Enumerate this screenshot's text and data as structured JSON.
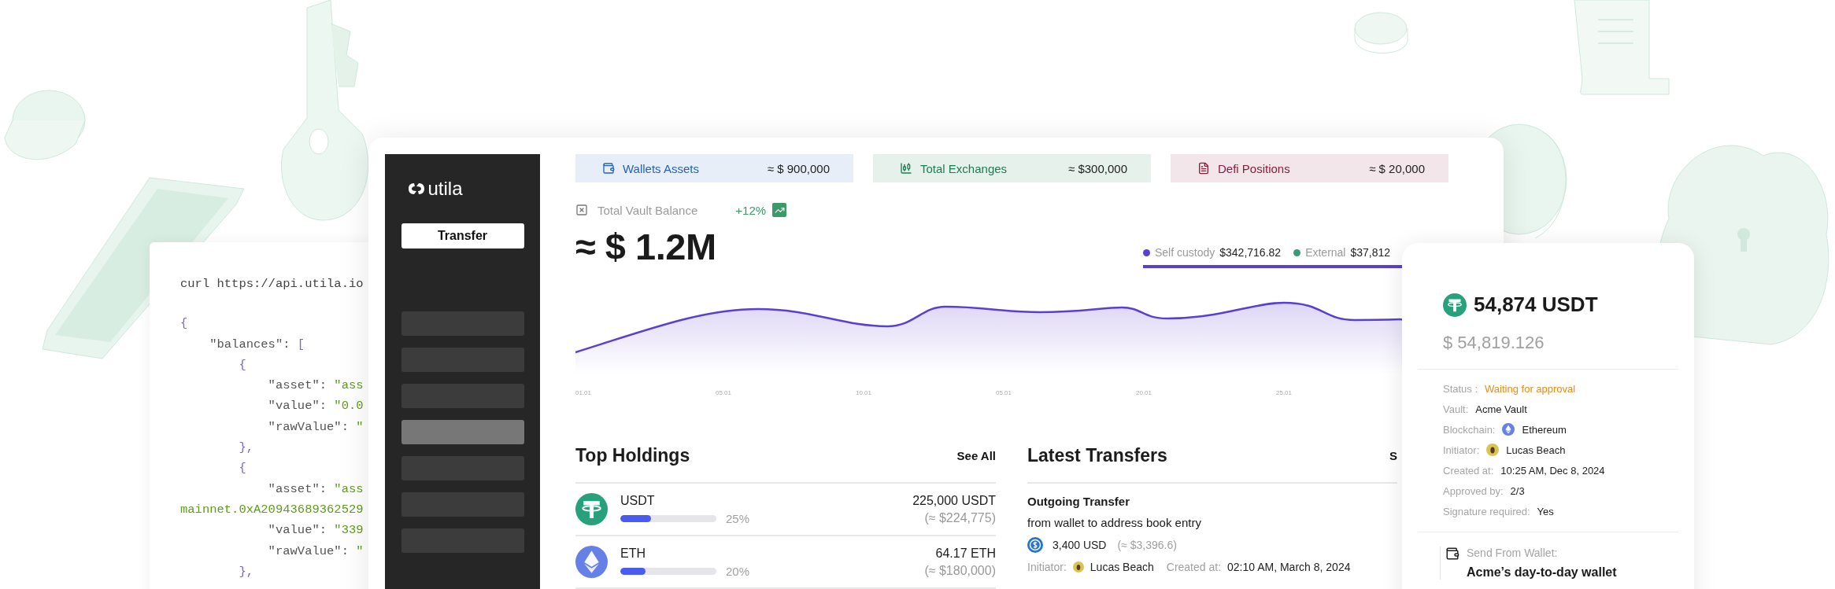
{
  "code_panel": {
    "command": "curl https://api.utila.io",
    "lines": [
      [
        {
          "kind": "punct",
          "text": "{"
        }
      ],
      [
        {
          "kind": "key",
          "text": "    \"balances\": "
        },
        {
          "kind": "punct",
          "text": "["
        }
      ],
      [
        {
          "kind": "punct",
          "text": "        {"
        }
      ],
      [
        {
          "kind": "key",
          "text": "            \"asset\": "
        },
        {
          "kind": "string",
          "text": "\"ass"
        }
      ],
      [
        {
          "kind": "key",
          "text": "            \"value\": "
        },
        {
          "kind": "string",
          "text": "\"0.0"
        }
      ],
      [
        {
          "kind": "key",
          "text": "            \"rawValue\": "
        },
        {
          "kind": "string",
          "text": "\""
        }
      ],
      [
        {
          "kind": "punct",
          "text": "        },"
        }
      ],
      [
        {
          "kind": "punct",
          "text": "        {"
        }
      ],
      [
        {
          "kind": "key",
          "text": "            \"asset\": "
        },
        {
          "kind": "string",
          "text": "\"ass"
        }
      ],
      [
        {
          "kind": "string",
          "text": "mainnet.0xA20943689362529"
        }
      ],
      [
        {
          "kind": "key",
          "text": "            \"value\": "
        },
        {
          "kind": "string",
          "text": "\"339"
        }
      ],
      [
        {
          "kind": "key",
          "text": "            \"rawValue\": "
        },
        {
          "kind": "string",
          "text": "\""
        }
      ],
      [
        {
          "kind": "punct",
          "text": "        },"
        }
      ]
    ]
  },
  "sidebar": {
    "brand": "utila",
    "action": "Transfer",
    "nav_items": [
      {
        "selected": false
      },
      {
        "selected": false
      },
      {
        "selected": false
      },
      {
        "selected": true
      },
      {
        "selected": false
      },
      {
        "selected": false
      },
      {
        "selected": false
      }
    ]
  },
  "summary_cards": [
    {
      "kind": "wallet",
      "label": "Wallets Assets",
      "value": "≈ $ 900,000",
      "color": "#2563b5"
    },
    {
      "kind": "exchange",
      "label": "Total Exchanges",
      "value": "≈ $300,000",
      "color": "#1b7d50"
    },
    {
      "kind": "document",
      "label": "Defi Positions",
      "value": "≈ $ 20,000",
      "color": "#8c1c3e"
    }
  ],
  "vault": {
    "label": "Total Vault Balance",
    "change": "+12%",
    "balance": "≈ $ 1.2M",
    "legend": [
      {
        "label": "Self custody",
        "value": "$342,716.82",
        "color": "#5b3fd1"
      },
      {
        "label": "External",
        "value": "$37,812",
        "color": "#3a9a78"
      }
    ],
    "x_labels": [
      "01.01",
      "05.01",
      "10.01",
      "05.01",
      "20.01",
      "25.01"
    ]
  },
  "top_holdings": {
    "title": "Top Holdings",
    "link": "See All",
    "rows": [
      {
        "kind": "usdt",
        "name": "USDT",
        "level": 0.32,
        "share": "25%",
        "amount": "225,000 USDT",
        "value": "(≈ $224,775)"
      },
      {
        "kind": "eth",
        "name": "ETH",
        "level": 0.26,
        "share": "20%",
        "amount": "64.17 ETH",
        "value": "(≈ $180,000)"
      }
    ]
  },
  "latest_transfers": {
    "title": "Latest Transfers",
    "link": "S",
    "transfer": {
      "title": "Outgoing Transfer",
      "description": "from wallet to address book entry",
      "amount": "3,400 USD",
      "amount_usd": "(≈ $3,396.6)",
      "initiator_label": "Initiator:",
      "initiator": "Lucas Beach",
      "created_label": "Created at:",
      "created": "02:10 AM, March 8, 2024"
    }
  },
  "detail_card": {
    "amount": "54,874 USDT",
    "fiat": "$ 54,819.126",
    "fields": [
      {
        "kind": "status",
        "label": "Status :",
        "value": "Waiting for approval"
      },
      {
        "kind": "text",
        "label": "Vault:",
        "value": "Acme Vault"
      },
      {
        "kind": "chain",
        "label": "Blockchain:",
        "value": "Ethereum"
      },
      {
        "kind": "person",
        "label": "Initiator:",
        "value": "Lucas Beach"
      },
      {
        "kind": "text",
        "label": "Created at:",
        "value": "10:25 AM, Dec 8, 2024"
      },
      {
        "kind": "text",
        "label": "Approved by:",
        "value": "2/3"
      },
      {
        "kind": "text",
        "label": "Signature required:",
        "value": "Yes"
      }
    ],
    "wallet_label": "Send From Wallet:",
    "wallet_name": "Acme’s day-to-day wallet"
  }
}
